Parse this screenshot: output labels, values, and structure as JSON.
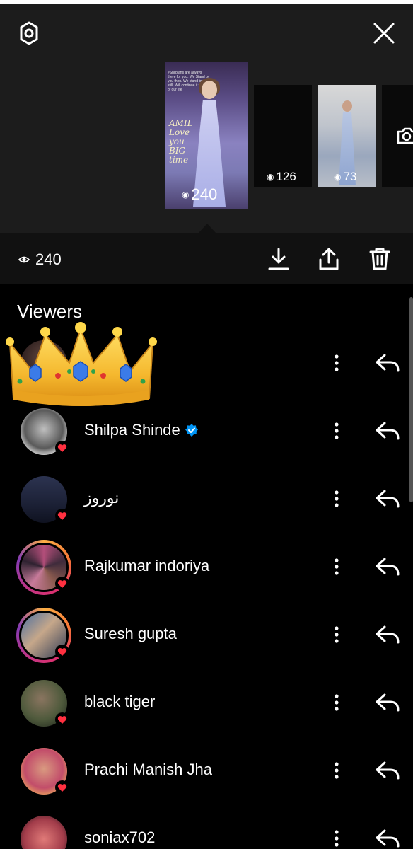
{
  "header": {
    "settings_icon": "gear-icon",
    "close_icon": "close-icon"
  },
  "stories": [
    {
      "views": "240"
    },
    {
      "views": "126"
    },
    {
      "views": "73"
    }
  ],
  "thumb_main": {
    "caption": "#Shilpians are always there for you. We Stand by you then. We stand by you still. Will continue it for rest of our life",
    "script_lines": [
      "AMIL",
      "Love",
      "you",
      "BIG",
      "time"
    ]
  },
  "action_bar": {
    "view_count": "240",
    "download_icon": "download-icon",
    "share_icon": "share-icon",
    "delete_icon": "trash-icon"
  },
  "viewers": {
    "title": "Viewers",
    "items": [
      {
        "name": "",
        "verified": false,
        "ring": false,
        "liked": false
      },
      {
        "name": "Shilpa Shinde",
        "verified": true,
        "ring": false,
        "liked": true
      },
      {
        "name": "نوروز",
        "verified": false,
        "ring": false,
        "liked": true
      },
      {
        "name": "Rajkumar indoriya",
        "verified": false,
        "ring": true,
        "liked": true
      },
      {
        "name": "Suresh gupta",
        "verified": false,
        "ring": true,
        "liked": true
      },
      {
        "name": "black tiger",
        "verified": false,
        "ring": false,
        "liked": true
      },
      {
        "name": "Prachi Manish Jha",
        "verified": false,
        "ring": false,
        "liked": true
      },
      {
        "name": "soniax702",
        "verified": false,
        "ring": false,
        "liked": false
      }
    ]
  },
  "colors": {
    "top_bg": "#1c1c1c",
    "bar_bg": "#111111",
    "page_bg": "#000000",
    "like_red": "#ff3040",
    "verified_blue": "#0095f6"
  },
  "emoji": "crown"
}
